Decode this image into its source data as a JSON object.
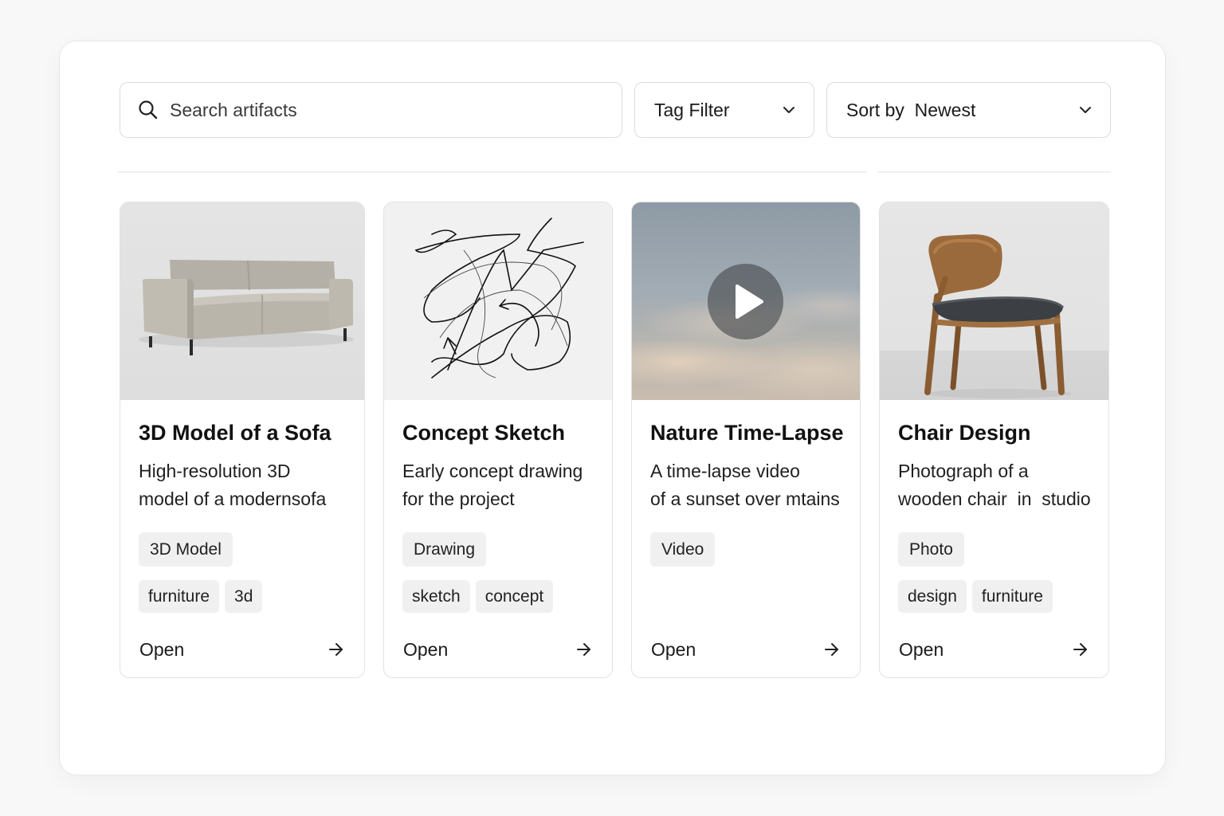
{
  "search": {
    "placeholder": "Search artifacts"
  },
  "filters": {
    "tag_label": "Tag Filter",
    "sort_label": "Sort by  Newest"
  },
  "cards": [
    {
      "title": "3D Model of a Sofa",
      "desc_line1": "High-resolution 3D",
      "desc_line2": "model of a modernsofa",
      "type": "3D Model",
      "tags": [
        "furniture",
        "3d"
      ],
      "action": "Open"
    },
    {
      "title": "Concept Sketch",
      "desc_line1": "Early concept drawing",
      "desc_line2": "for the project",
      "type": "Drawing",
      "tags": [
        "sketch",
        "concept"
      ],
      "action": "Open"
    },
    {
      "title": "Nature Time-Lapse",
      "desc_line1": "A time-lapse video",
      "desc_line2": "of a sunset over mtains",
      "type": "Video",
      "tags": [],
      "action": "Open"
    },
    {
      "title": "Chair Design",
      "desc_line1": "Photograph of a",
      "desc_line2": "wooden chair  in  studio",
      "type": "Photo",
      "tags": [
        "design",
        "furniture"
      ],
      "action": "Open"
    }
  ]
}
